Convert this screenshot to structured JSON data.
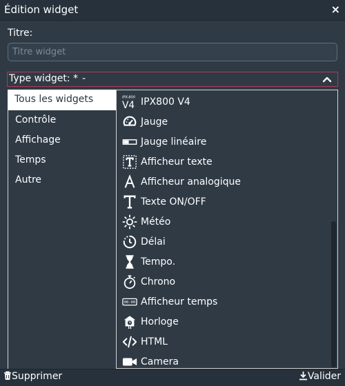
{
  "dialog": {
    "title": "Édition widget",
    "close_icon": "×"
  },
  "form": {
    "title_label": "Titre:",
    "title_placeholder": "Titre widget",
    "title_value": "",
    "type_label": "Type widget: *",
    "type_value": "-"
  },
  "categories": [
    {
      "label": "Tous les widgets",
      "selected": true
    },
    {
      "label": "Contrôle",
      "selected": false
    },
    {
      "label": "Affichage",
      "selected": false
    },
    {
      "label": "Temps",
      "selected": false
    },
    {
      "label": "Autre",
      "selected": false
    }
  ],
  "widgets": [
    {
      "label": "IPX800 V4",
      "icon": "ipx800-v4-icon",
      "icon_caption_small": "IPX-800",
      "icon_caption_big": "V4"
    },
    {
      "label": "Jauge",
      "icon": "gauge-icon"
    },
    {
      "label": "Jauge linéaire",
      "icon": "linear-gauge-icon"
    },
    {
      "label": "Afficheur texte",
      "icon": "text-box-icon"
    },
    {
      "label": "Afficheur analogique",
      "icon": "letter-a-icon"
    },
    {
      "label": "Texte ON/OFF",
      "icon": "letter-t-icon"
    },
    {
      "label": "Météo",
      "icon": "sun-icon"
    },
    {
      "label": "Délai",
      "icon": "timer-icon"
    },
    {
      "label": "Tempo.",
      "icon": "hourglass-icon"
    },
    {
      "label": "Chrono",
      "icon": "stopwatch-icon"
    },
    {
      "label": "Afficheur temps",
      "icon": "digital-clock-icon",
      "icon_caption": "00:00"
    },
    {
      "label": "Horloge",
      "icon": "cuckoo-clock-icon"
    },
    {
      "label": "HTML",
      "icon": "code-icon"
    },
    {
      "label": "Camera",
      "icon": "video-camera-icon"
    }
  ],
  "footer": {
    "delete_label": "Supprimer",
    "validate_label": "Valider"
  },
  "colors": {
    "background": "#2f3a45",
    "titlebar": "#27313b",
    "accent_border": "#b23a55",
    "list_border": "#d6d6d6"
  }
}
